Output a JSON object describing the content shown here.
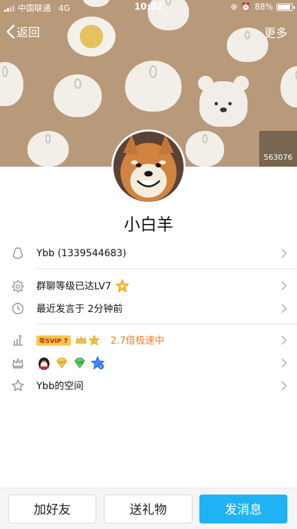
{
  "status_bar": {
    "carrier": "中国联通",
    "network": "4G",
    "time": "10:02",
    "battery": "88%",
    "battery_level": 0.88
  },
  "nav": {
    "back_label": "返回",
    "more_label": "更多"
  },
  "profile": {
    "likes": "563076",
    "nickname": "小白羊"
  },
  "rows": {
    "account": "Ybb (1339544683)",
    "group_level": "群聊等级已达LV7",
    "last_speak": "最近发言于 2分钟前",
    "svip_tag": "年SVIP 7",
    "speed": "2.7倍极速中",
    "space": "Ybb的空间"
  },
  "actions": {
    "add_friend": "加好友",
    "send_gift": "送礼物",
    "send_message": "发消息"
  },
  "colors": {
    "accent": "#1fb2f5",
    "speed_text": "#ef7e1f",
    "banner": "#b8997a"
  }
}
